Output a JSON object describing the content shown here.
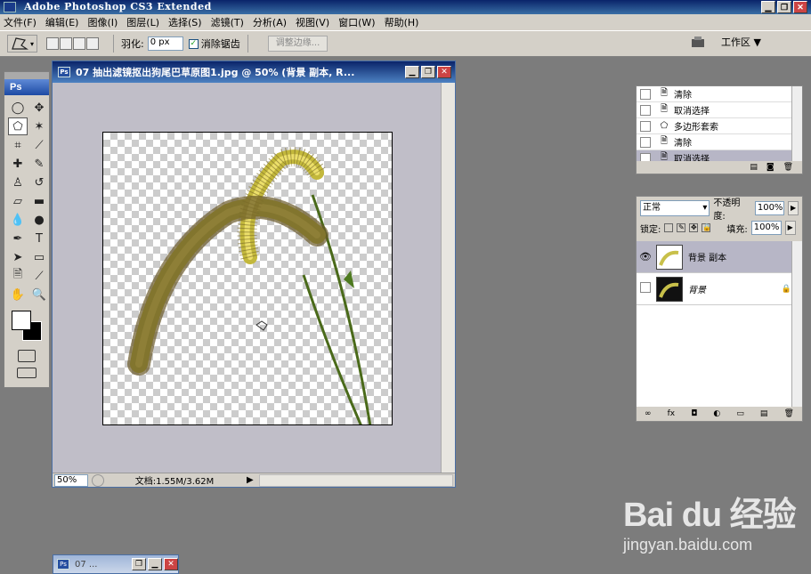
{
  "app": {
    "title": "Adobe Photoshop CS3 Extended",
    "win_minimize": "▁",
    "win_restore": "❐",
    "win_close": "✕"
  },
  "menubar": [
    "文件(F)",
    "编辑(E)",
    "图像(I)",
    "图层(L)",
    "选择(S)",
    "滤镜(T)",
    "分析(A)",
    "视图(V)",
    "窗口(W)",
    "帮助(H)"
  ],
  "options": {
    "feather_label": "羽化:",
    "feather_value": "0 px",
    "antialias_label": "消除锯齿",
    "antialias_checked": "✓",
    "refine_edge": "调整边缘...",
    "workspace": "工作区 ▼"
  },
  "toolbox": {
    "logo": "Ps",
    "tools": [
      {
        "name": "elliptical-marquee-icon",
        "glyph": "◯"
      },
      {
        "name": "move-icon",
        "glyph": "✥"
      },
      {
        "name": "polygonal-lasso-icon",
        "glyph": "⬠"
      },
      {
        "name": "magic-wand-icon",
        "glyph": "✶"
      },
      {
        "name": "crop-icon",
        "glyph": "⌗"
      },
      {
        "name": "eyedropper-icon",
        "glyph": "⟋"
      },
      {
        "name": "healing-brush-icon",
        "glyph": "✚"
      },
      {
        "name": "brush-icon",
        "glyph": "✎"
      },
      {
        "name": "clone-stamp-icon",
        "glyph": "♙"
      },
      {
        "name": "history-brush-icon",
        "glyph": "↺"
      },
      {
        "name": "eraser-icon",
        "glyph": "▱"
      },
      {
        "name": "gradient-icon",
        "glyph": "▬"
      },
      {
        "name": "blur-icon",
        "glyph": "💧"
      },
      {
        "name": "dodge-icon",
        "glyph": "●"
      },
      {
        "name": "pen-icon",
        "glyph": "✒"
      },
      {
        "name": "type-icon",
        "glyph": "T"
      },
      {
        "name": "path-select-icon",
        "glyph": "➤"
      },
      {
        "name": "rectangle-shape-icon",
        "glyph": "▭"
      },
      {
        "name": "notes-icon",
        "glyph": "🗎"
      },
      {
        "name": "color-sampler-icon",
        "glyph": "⟋"
      },
      {
        "name": "hand-icon",
        "glyph": "✋"
      },
      {
        "name": "zoom-icon",
        "glyph": "🔍"
      }
    ]
  },
  "document": {
    "title": "07 抽出滤镜抠出狗尾巴草原图1.jpg @ 50% (背景 副本, R...",
    "zoom": "50%",
    "info": "文档:1.55M/3.62M"
  },
  "history": {
    "items": [
      {
        "label": "清除",
        "icon": "doc"
      },
      {
        "label": "取消选择",
        "icon": "doc"
      },
      {
        "label": "多边形套索",
        "icon": "lasso"
      },
      {
        "label": "清除",
        "icon": "doc"
      },
      {
        "label": "取消选择",
        "icon": "doc",
        "selected": true
      }
    ]
  },
  "layers": {
    "blend_mode": "正常",
    "opacity_label": "不透明度:",
    "opacity_value": "100%",
    "lock_label": "锁定:",
    "fill_label": "填充:",
    "fill_value": "100%",
    "items": [
      {
        "name": "背景 副本",
        "visible": true,
        "selected": true
      },
      {
        "name": "背景",
        "visible": false,
        "locked": true
      }
    ],
    "footer_link": "∞",
    "footer_fx": "fx"
  },
  "minimized": {
    "title": "07 ..."
  },
  "watermark": {
    "logo": "Bai du 经验",
    "url": "jingyan.baidu.com"
  }
}
